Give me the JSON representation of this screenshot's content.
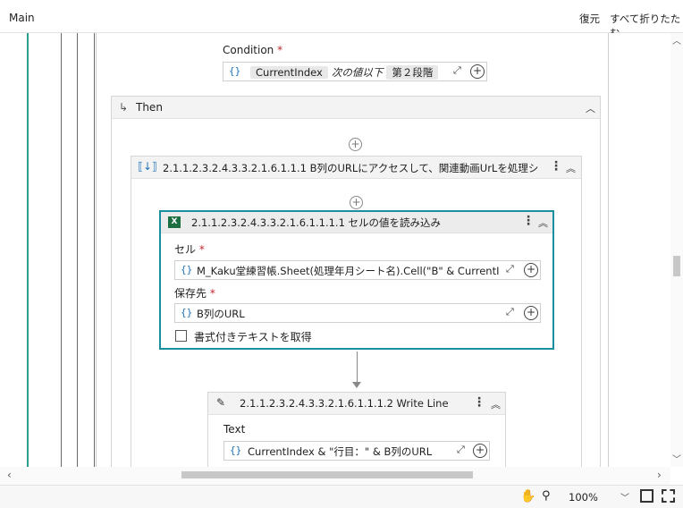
{
  "topbar": {
    "title": "Main",
    "restore_label": "復元",
    "collapse_all_label": "すべて折りたたむ"
  },
  "if_activity": {
    "condition_label": "Condition",
    "required_mark": "*",
    "condition": {
      "left": "CurrentIndex",
      "operator": "次の値以下",
      "right": "第２段階"
    },
    "then_label": "Then"
  },
  "sequence": {
    "title": "2.1.1.2.3.2.4.3.3.2.1.6.1.1.1 B列のURLにアクセスして、関連動画UrLを処理シートに追記"
  },
  "read_cell": {
    "title": "2.1.1.2.3.2.4.3.3.2.1.6.1.1.1.1 セルの値を読み込み",
    "cell_label": "セル",
    "cell_value": "M_Kaku堂練習帳.Sheet(処理年月シート名).Cell(\"B\" & CurrentInd",
    "save_label": "保存先",
    "save_value": "B列のURL",
    "rich_text_label": "書式付きテキストを取得"
  },
  "write_line": {
    "title": "2.1.1.2.3.2.4.3.3.2.1.6.1.1.1.2 Write Line",
    "text_label": "Text",
    "text_value": "CurrentIndex & \"行目：\" & B列のURL"
  },
  "statusbar": {
    "zoom": "100%"
  },
  "colors": {
    "accent": "#1a8fa0",
    "canvas_line": "#2aa08d",
    "excel_green": "#1d6f42"
  }
}
